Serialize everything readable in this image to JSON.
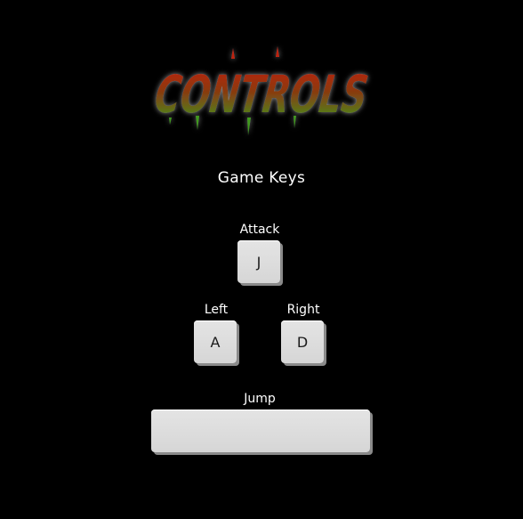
{
  "title": "CONTROLS",
  "subtitle": "Game Keys",
  "keys": {
    "attack": {
      "label": "Attack",
      "key": "J"
    },
    "left": {
      "label": "Left",
      "key": "A"
    },
    "right": {
      "label": "Right",
      "key": "D"
    },
    "jump": {
      "label": "Jump",
      "key": ""
    }
  },
  "colors": {
    "background": "#000000",
    "title_red": "#b01e10",
    "title_green": "#3a8a1e",
    "title_glow": "#ffffff",
    "key_face": "#dcdcdc",
    "key_shadow": "#8a8a8a"
  }
}
